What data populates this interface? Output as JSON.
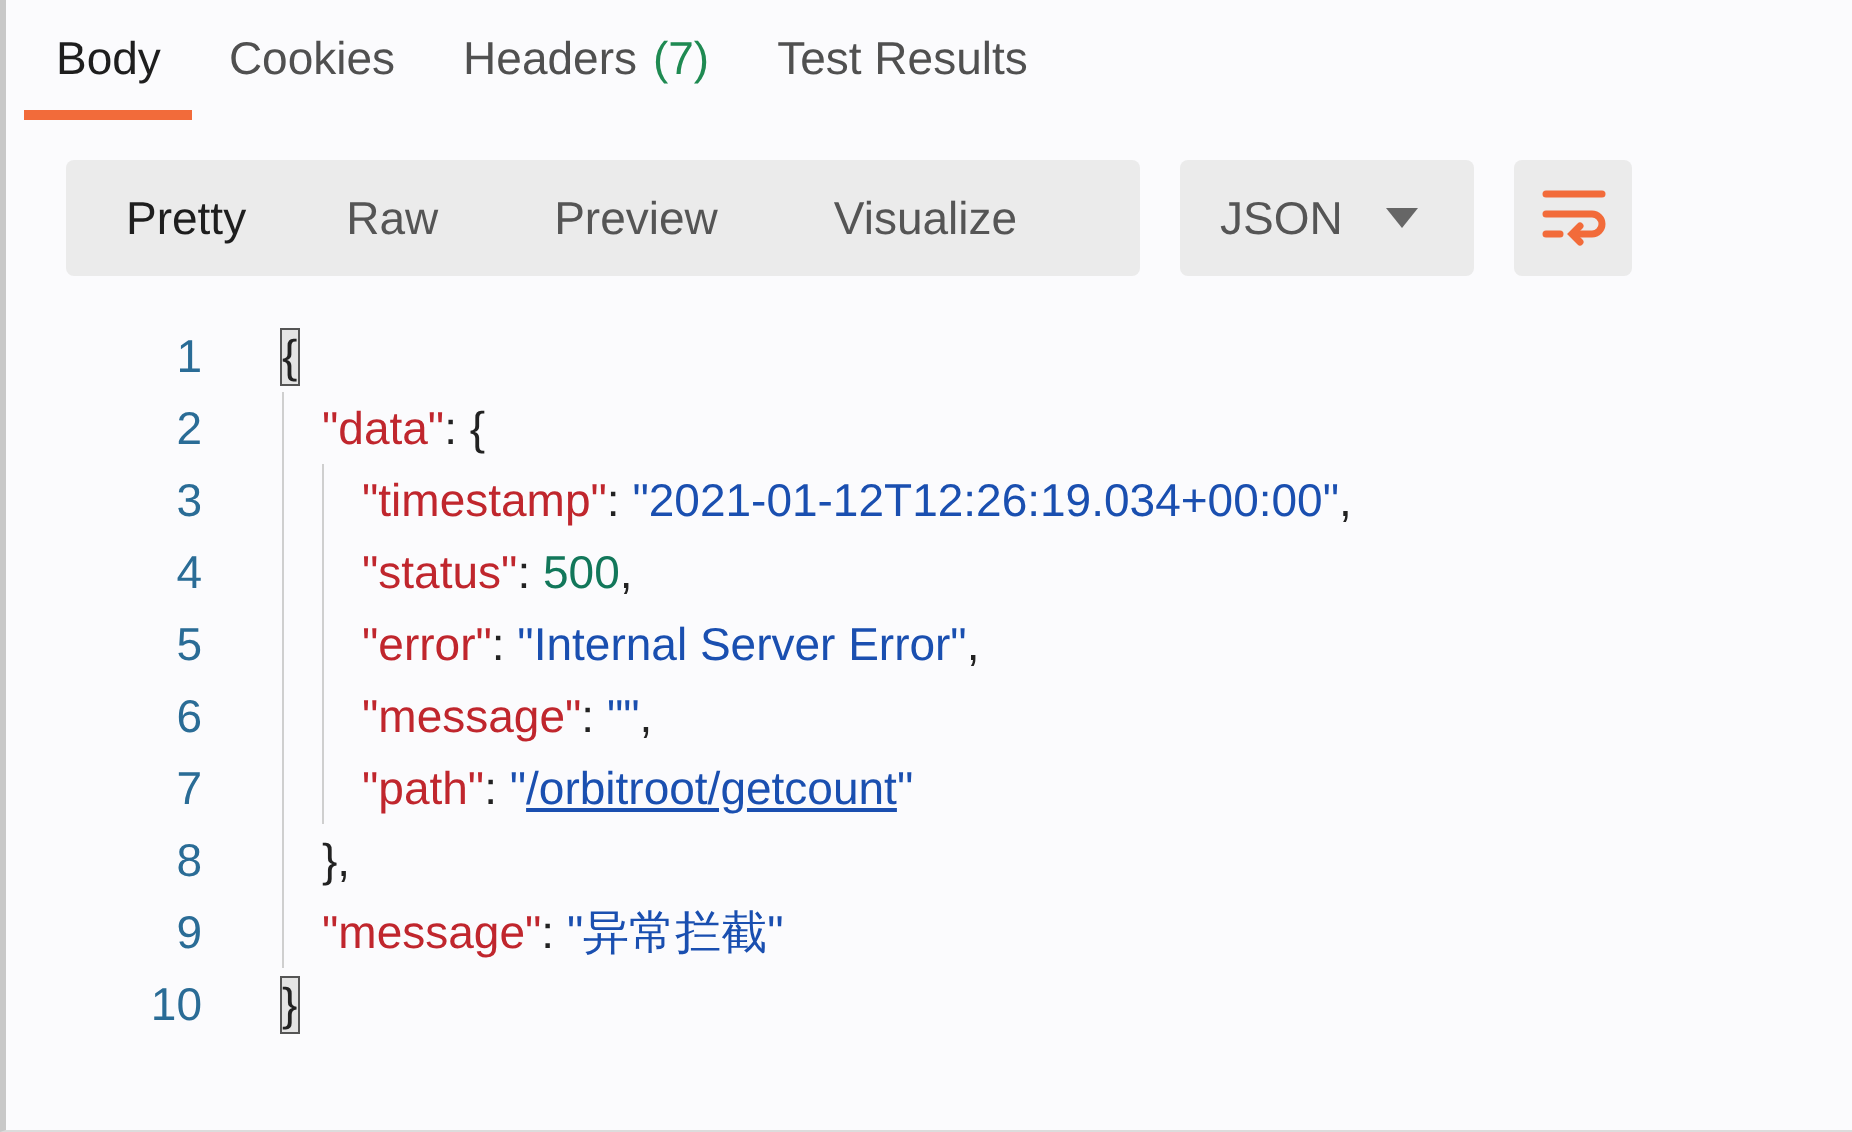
{
  "tabs": [
    {
      "label": "Body",
      "selected": true
    },
    {
      "label": "Cookies",
      "selected": false
    },
    {
      "label": "Headers",
      "count": "(7)",
      "selected": false
    },
    {
      "label": "Test Results",
      "selected": false
    }
  ],
  "view_modes": [
    {
      "label": "Pretty",
      "selected": true
    },
    {
      "label": "Raw",
      "selected": false
    },
    {
      "label": "Preview",
      "selected": false
    },
    {
      "label": "Visualize",
      "selected": false
    }
  ],
  "format_dropdown": {
    "value": "JSON"
  },
  "wrap_button": {
    "on": true
  },
  "code_lines": [
    {
      "number": "1",
      "tokens": [
        {
          "kind": "punct",
          "text": "{",
          "highlighted": true
        }
      ],
      "children": [
        {
          "number": "2",
          "tokens": [
            {
              "kind": "key",
              "text": "\"data\"",
              "highlighted": false
            },
            {
              "kind": "punct",
              "text": ": {",
              "highlighted": false
            }
          ],
          "children": [
            {
              "number": "3",
              "tokens": [
                {
                  "kind": "key",
                  "text": "\"timestamp\"",
                  "highlighted": false
                },
                {
                  "kind": "punct",
                  "text": ": ",
                  "highlighted": false
                },
                {
                  "kind": "string",
                  "text": "\"2021-01-12T12:26:19.034+00:00\"",
                  "highlighted": false
                },
                {
                  "kind": "punct",
                  "text": ",",
                  "highlighted": false
                }
              ]
            },
            {
              "number": "4",
              "tokens": [
                {
                  "kind": "key",
                  "text": "\"status\"",
                  "highlighted": false
                },
                {
                  "kind": "punct",
                  "text": ": ",
                  "highlighted": false
                },
                {
                  "kind": "number",
                  "text": "500",
                  "highlighted": false
                },
                {
                  "kind": "punct",
                  "text": ",",
                  "highlighted": false
                }
              ]
            },
            {
              "number": "5",
              "tokens": [
                {
                  "kind": "key",
                  "text": "\"error\"",
                  "highlighted": false
                },
                {
                  "kind": "punct",
                  "text": ": ",
                  "highlighted": false
                },
                {
                  "kind": "string",
                  "text": "\"Internal Server Error\"",
                  "highlighted": false
                },
                {
                  "kind": "punct",
                  "text": ",",
                  "highlighted": false
                }
              ]
            },
            {
              "number": "6",
              "tokens": [
                {
                  "kind": "key",
                  "text": "\"message\"",
                  "highlighted": false
                },
                {
                  "kind": "punct",
                  "text": ": ",
                  "highlighted": false
                },
                {
                  "kind": "string",
                  "text": "\"\"",
                  "highlighted": false
                },
                {
                  "kind": "punct",
                  "text": ",",
                  "highlighted": false
                }
              ]
            },
            {
              "number": "7",
              "tokens": [
                {
                  "kind": "key",
                  "text": "\"path\"",
                  "highlighted": false
                },
                {
                  "kind": "punct",
                  "text": ": ",
                  "highlighted": false
                },
                {
                  "kind": "string",
                  "text": "\"",
                  "highlighted": false
                },
                {
                  "kind": "link",
                  "text": "/orbitroot/getcount",
                  "highlighted": false
                },
                {
                  "kind": "string",
                  "text": "\"",
                  "highlighted": false
                }
              ]
            }
          ]
        },
        {
          "number": "8",
          "tokens": [
            {
              "kind": "punct",
              "text": "},",
              "highlighted": false
            }
          ]
        },
        {
          "number": "9",
          "tokens": [
            {
              "kind": "key",
              "text": "\"message\"",
              "highlighted": false
            },
            {
              "kind": "punct",
              "text": ": ",
              "highlighted": false
            },
            {
              "kind": "string",
              "text": "\"异常拦截\"",
              "highlighted": false
            }
          ]
        }
      ]
    },
    {
      "number": "10",
      "tokens": [
        {
          "kind": "punct",
          "text": "}",
          "highlighted": true
        }
      ]
    }
  ]
}
